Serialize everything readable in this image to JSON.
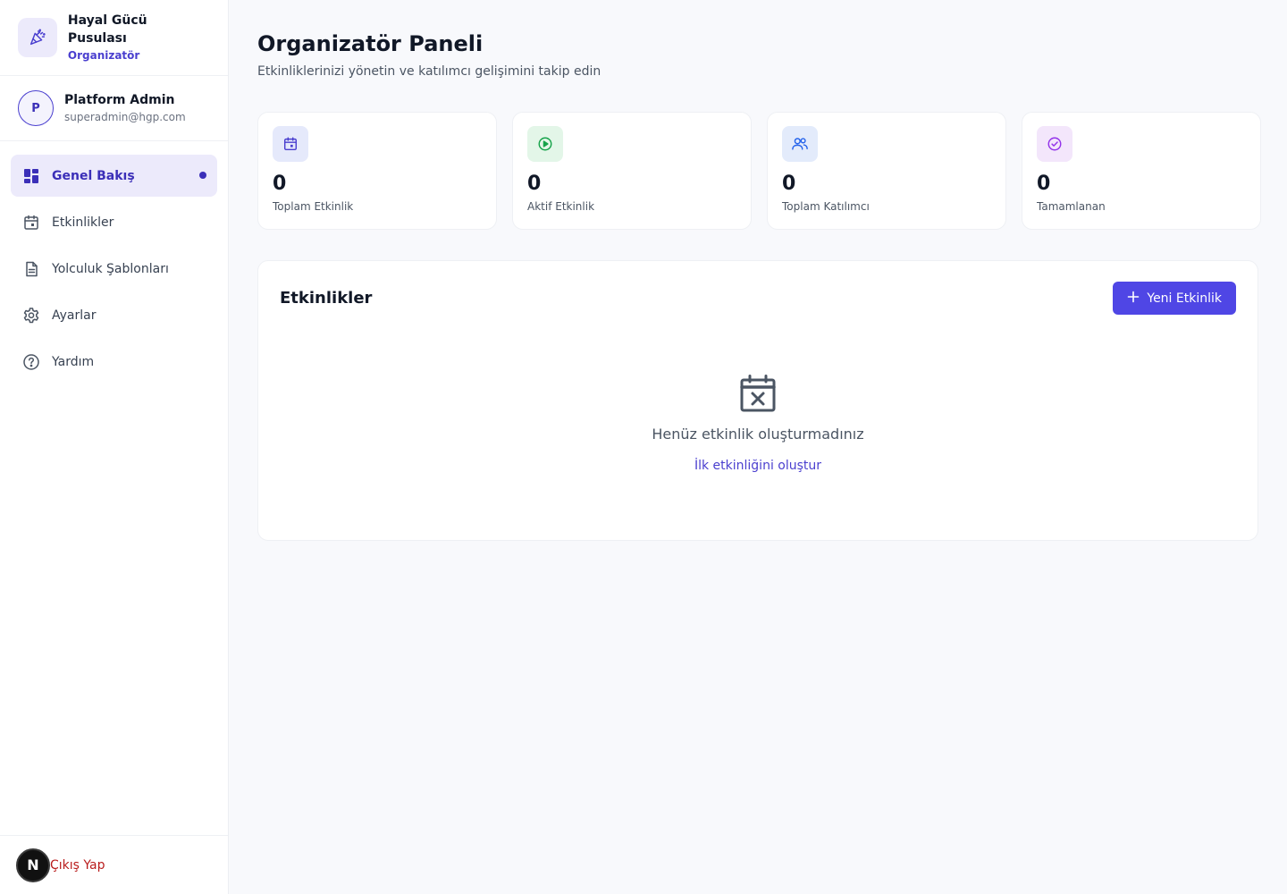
{
  "brand": {
    "name": "Hayal Gücü Pusulası",
    "role": "Organizatör"
  },
  "user": {
    "initial": "P",
    "name": "Platform Admin",
    "email": "superadmin@hgp.com"
  },
  "nav": {
    "items": [
      {
        "label": "Genel Bakış",
        "icon": "dashboard-icon",
        "active": true
      },
      {
        "label": "Etkinlikler",
        "icon": "calendar-icon",
        "active": false
      },
      {
        "label": "Yolculuk Şablonları",
        "icon": "document-icon",
        "active": false
      },
      {
        "label": "Ayarlar",
        "icon": "gear-icon",
        "active": false
      },
      {
        "label": "Yardım",
        "icon": "help-icon",
        "active": false
      }
    ]
  },
  "footer": {
    "badge": "N",
    "logout_label": "Çıkış Yap"
  },
  "page": {
    "title": "Organizatör Paneli",
    "subtitle": "Etkinliklerinizi yönetin ve katılımcı gelişimini takip edin"
  },
  "stats": [
    {
      "value": "0",
      "label": "Toplam Etkinlik",
      "icon": "calendar-icon",
      "bg": "#e5e9fb",
      "color": "#4a3fcf"
    },
    {
      "value": "0",
      "label": "Aktif Etkinlik",
      "icon": "play-icon",
      "bg": "#e3f6e8",
      "color": "#16a34a"
    },
    {
      "value": "0",
      "label": "Toplam Katılımcı",
      "icon": "users-icon",
      "bg": "#e3ebfb",
      "color": "#2563eb"
    },
    {
      "value": "0",
      "label": "Tamamlanan",
      "icon": "check-circle-icon",
      "bg": "#f3e6fb",
      "color": "#9333ea"
    }
  ],
  "events": {
    "title": "Etkinlikler",
    "new_button_label": "Yeni Etkinlik",
    "empty_text": "Henüz etkinlik oluşturmadınız",
    "empty_link": "İlk etkinliğini oluştur",
    "empty_icon": "calendar-x-icon"
  },
  "colors": {
    "accent": "#4f46e5",
    "accent_dark": "#3b2fb8",
    "danger": "#b91c1c"
  }
}
